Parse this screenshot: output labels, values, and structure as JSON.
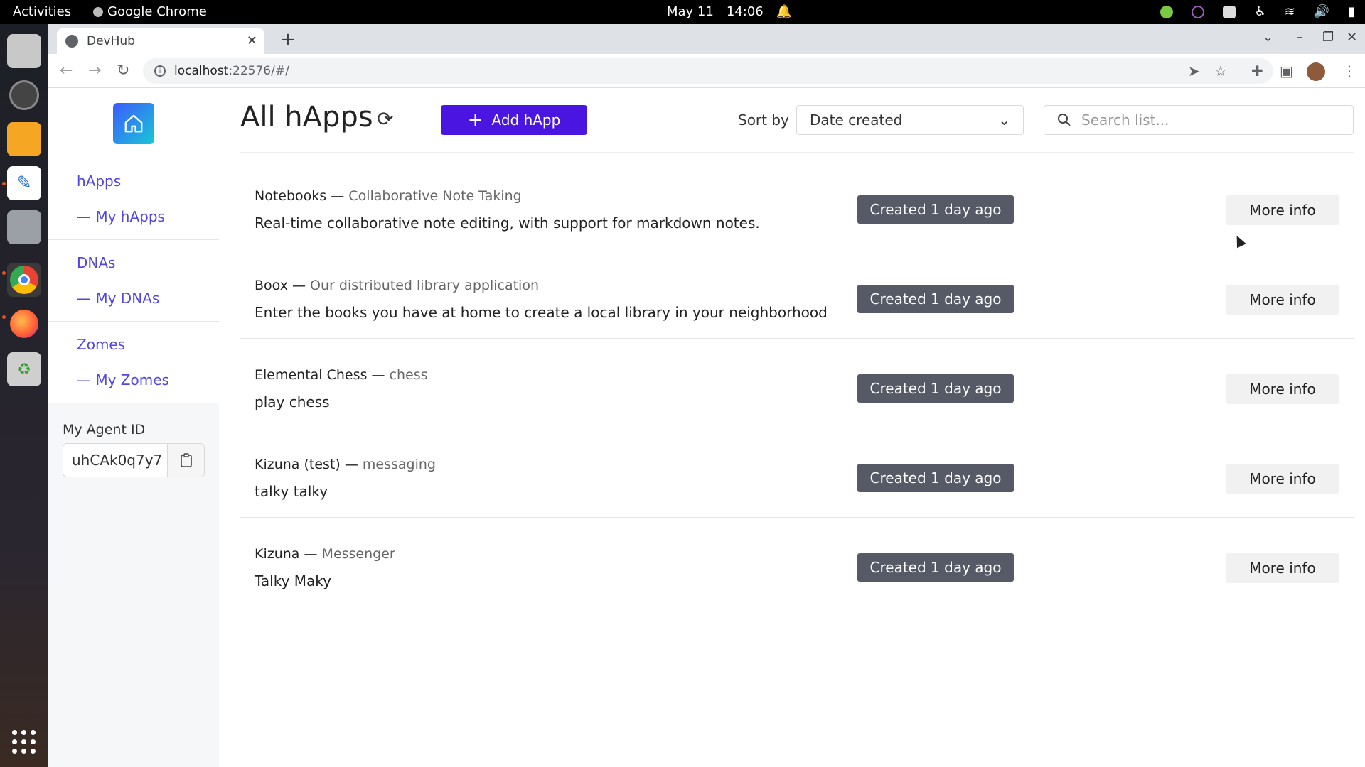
{
  "os": {
    "activities": "Activities",
    "app_name": "Google Chrome",
    "date": "May 11",
    "time": "14:06"
  },
  "browser": {
    "tab_title": "DevHub",
    "url_host": "localhost",
    "url_rest": ":22576/#/"
  },
  "sidebar": {
    "groups": [
      {
        "label": "hApps",
        "sub": "— My hApps"
      },
      {
        "label": "DNAs",
        "sub": "— My DNAs"
      },
      {
        "label": "Zomes",
        "sub": "— My Zomes"
      }
    ],
    "agent_label": "My Agent ID",
    "agent_value": "uhCAk0q7y7"
  },
  "header": {
    "title": "All hApps",
    "add_label": "Add hApp",
    "sort_label": "Sort by",
    "sort_value": "Date created",
    "search_placeholder": "Search list..."
  },
  "items": [
    {
      "name": "Notebooks",
      "subtitle": "Collaborative Note Taking",
      "description": "Real-time collaborative note editing, with support for markdown notes.",
      "badge": "Created 1 day ago",
      "action": "More info"
    },
    {
      "name": "Boox",
      "subtitle": "Our distributed library application",
      "description": "Enter the books you have at home to create a local library in your neighborhood",
      "badge": "Created 1 day ago",
      "action": "More info"
    },
    {
      "name": "Elemental Chess",
      "subtitle": "chess",
      "description": "play chess",
      "badge": "Created 1 day ago",
      "action": "More info"
    },
    {
      "name": "Kizuna (test)",
      "subtitle": "messaging",
      "description": "talky talky",
      "badge": "Created 1 day ago",
      "action": "More info"
    },
    {
      "name": "Kizuna",
      "subtitle": "Messenger",
      "description": "Talky Maky",
      "badge": "Created 1 day ago",
      "action": "More info"
    }
  ],
  "colors": {
    "accent": "#4a15e0",
    "link": "#4f46e5",
    "badge": "#565a66"
  }
}
